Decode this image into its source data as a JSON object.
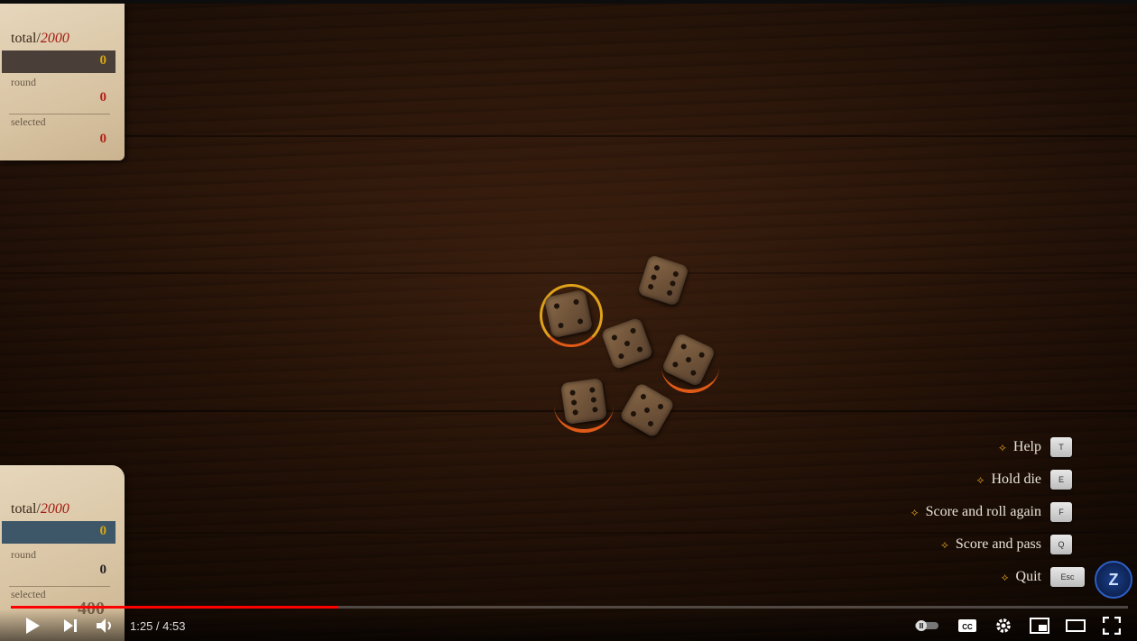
{
  "player_card": {
    "total_label": "total",
    "goal": "2000",
    "total_value": "0",
    "round_label": "round",
    "round_value": "0",
    "selected_label": "selected",
    "selected_value": "0"
  },
  "opponent_card": {
    "total_label": "total",
    "goal": "2000",
    "total_value": "0",
    "round_label": "round",
    "round_value": "0",
    "selected_label": "selected",
    "ghost_value": "400"
  },
  "controls_help": [
    {
      "label": "Help",
      "key": "T"
    },
    {
      "label": "Hold die",
      "key": "E"
    },
    {
      "label": "Score and roll again",
      "key": "F"
    },
    {
      "label": "Score and pass",
      "key": "Q"
    },
    {
      "label": "Quit",
      "key": "Esc"
    }
  ],
  "channel_logo": "Z",
  "player": {
    "time": "1:25 / 4:53",
    "progress": 0.293
  },
  "colors": {
    "goal_red": "#a21b12",
    "selection_ring": "#e0a21a",
    "progress_red": "#ff0000"
  }
}
